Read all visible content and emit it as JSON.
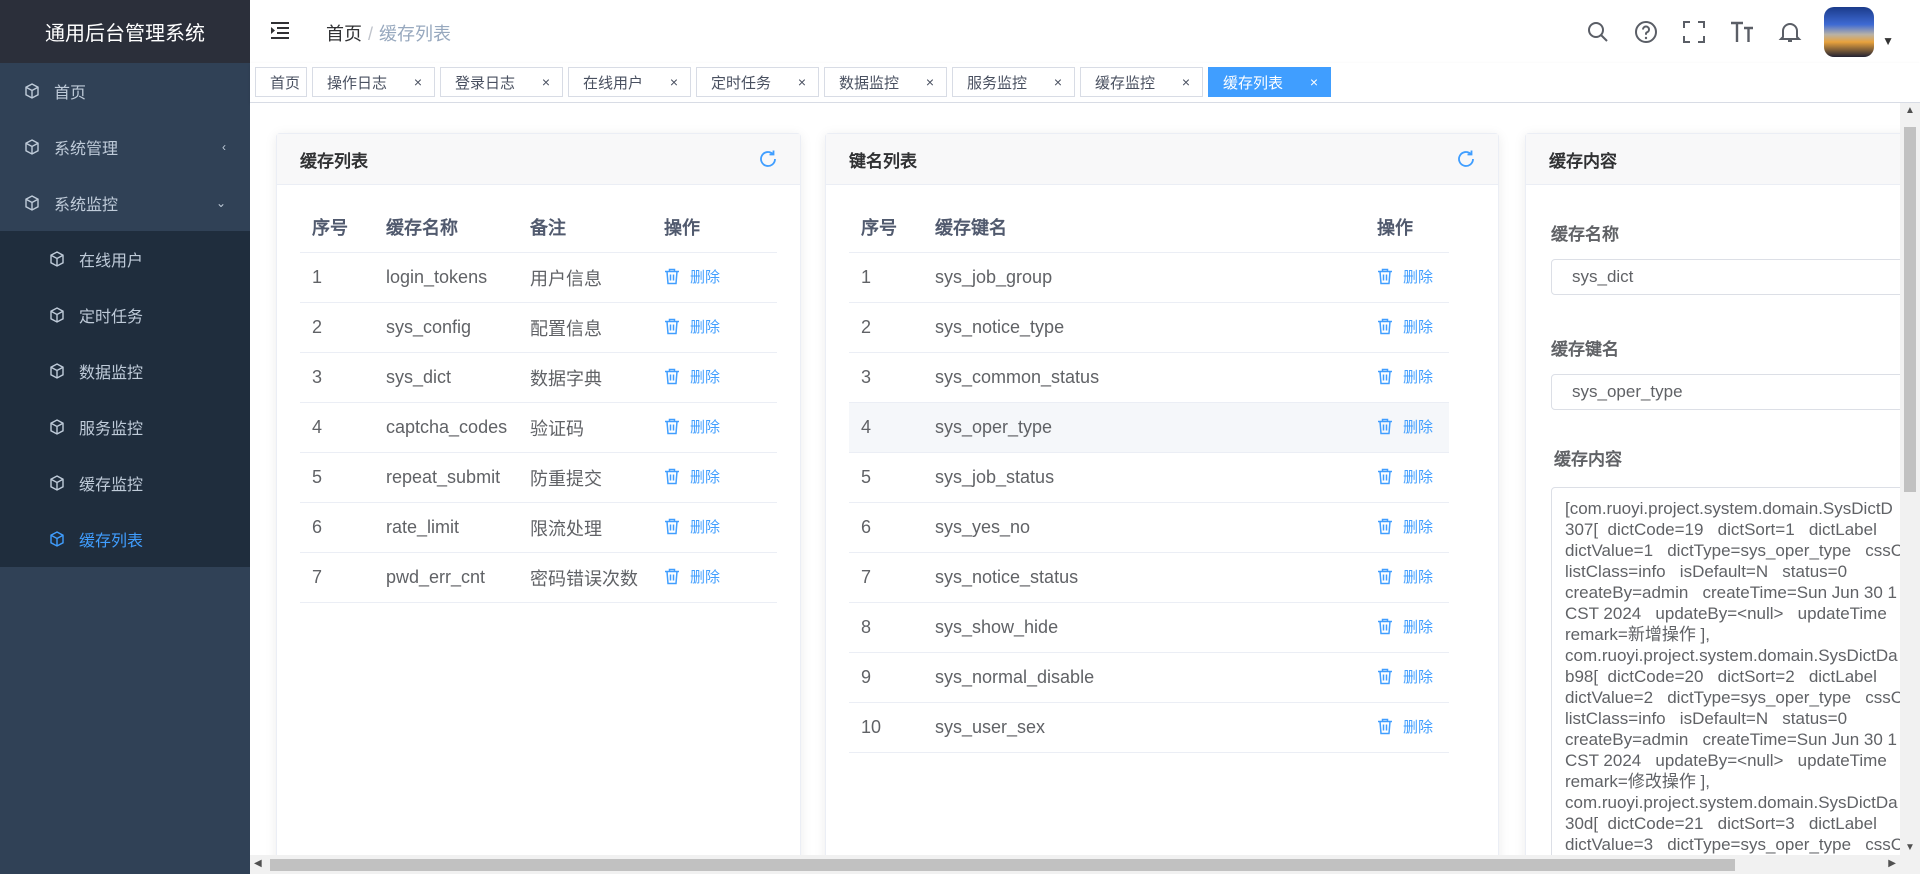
{
  "app": {
    "title": "通用后台管理系统"
  },
  "sidebar": {
    "items": [
      {
        "label": "首页",
        "icon": "cube-icon"
      },
      {
        "label": "系统管理",
        "icon": "cube-icon",
        "arrow": "‹"
      },
      {
        "label": "系统监控",
        "icon": "cube-icon",
        "arrow": "⌄"
      }
    ],
    "subitems": [
      {
        "label": "在线用户"
      },
      {
        "label": "定时任务"
      },
      {
        "label": "数据监控"
      },
      {
        "label": "服务监控"
      },
      {
        "label": "缓存监控"
      },
      {
        "label": "缓存列表",
        "active": true
      }
    ]
  },
  "breadcrumb": {
    "home": "首页",
    "sep": "/",
    "current": "缓存列表"
  },
  "tags": [
    {
      "label": "首页",
      "closable": false
    },
    {
      "label": "操作日志",
      "closable": true
    },
    {
      "label": "登录日志",
      "closable": true
    },
    {
      "label": "在线用户",
      "closable": true
    },
    {
      "label": "定时任务",
      "closable": true
    },
    {
      "label": "数据监控",
      "closable": true
    },
    {
      "label": "服务监控",
      "closable": true
    },
    {
      "label": "缓存监控",
      "closable": true
    },
    {
      "label": "缓存列表",
      "closable": true,
      "active": true
    }
  ],
  "tag_close": "×",
  "cache_list": {
    "title": "缓存列表",
    "headers": [
      "序号",
      "缓存名称",
      "备注",
      "操作"
    ],
    "rows": [
      {
        "no": "1",
        "name": "login_tokens",
        "remark": "用户信息"
      },
      {
        "no": "2",
        "name": "sys_config",
        "remark": "配置信息"
      },
      {
        "no": "3",
        "name": "sys_dict",
        "remark": "数据字典"
      },
      {
        "no": "4",
        "name": "captcha_codes",
        "remark": "验证码"
      },
      {
        "no": "5",
        "name": "repeat_submit",
        "remark": "防重提交"
      },
      {
        "no": "6",
        "name": "rate_limit",
        "remark": "限流处理"
      },
      {
        "no": "7",
        "name": "pwd_err_cnt",
        "remark": "密码错误次数"
      }
    ],
    "delete_label": "删除"
  },
  "key_list": {
    "title": "键名列表",
    "headers": [
      "序号",
      "缓存键名",
      "操作"
    ],
    "rows": [
      {
        "no": "1",
        "key": "sys_job_group"
      },
      {
        "no": "2",
        "key": "sys_notice_type"
      },
      {
        "no": "3",
        "key": "sys_common_status"
      },
      {
        "no": "4",
        "key": "sys_oper_type",
        "highlight": true
      },
      {
        "no": "5",
        "key": "sys_job_status"
      },
      {
        "no": "6",
        "key": "sys_yes_no"
      },
      {
        "no": "7",
        "key": "sys_notice_status"
      },
      {
        "no": "8",
        "key": "sys_show_hide"
      },
      {
        "no": "9",
        "key": "sys_normal_disable"
      },
      {
        "no": "10",
        "key": "sys_user_sex"
      }
    ],
    "delete_label": "删除"
  },
  "cache_content": {
    "title": "缓存内容",
    "name_label": "缓存名称",
    "name_value": "sys_dict",
    "key_label": "缓存键名",
    "key_value": "sys_oper_type",
    "content_label": "缓存内容",
    "content_lines": [
      "[com.ruoyi.project.system.domain.SysDictD",
      "307[  dictCode=19   dictSort=1   dictLabel",
      "dictValue=1   dictType=sys_oper_type   cssC",
      "listClass=info   isDefault=N   status=0",
      "createBy=admin   createTime=Sun Jun 30 1",
      "CST 2024   updateBy=<null>   updateTime",
      "remark=新增操作 ],",
      "com.ruoyi.project.system.domain.SysDictDa",
      "b98[  dictCode=20   dictSort=2   dictLabel",
      "dictValue=2   dictType=sys_oper_type   cssC",
      "listClass=info   isDefault=N   status=0",
      "createBy=admin   createTime=Sun Jun 30 1",
      "CST 2024   updateBy=<null>   updateTime",
      "remark=修改操作 ],",
      "com.ruoyi.project.system.domain.SysDictDa",
      "30d[  dictCode=21   dictSort=3   dictLabel",
      "dictValue=3   dictType=sys_oper_type   cssC"
    ]
  },
  "colors": {
    "sidebar": "#304156",
    "logo_bg": "#2b2f3a",
    "submenu": "#1f2d3d",
    "accent": "#409eff"
  }
}
